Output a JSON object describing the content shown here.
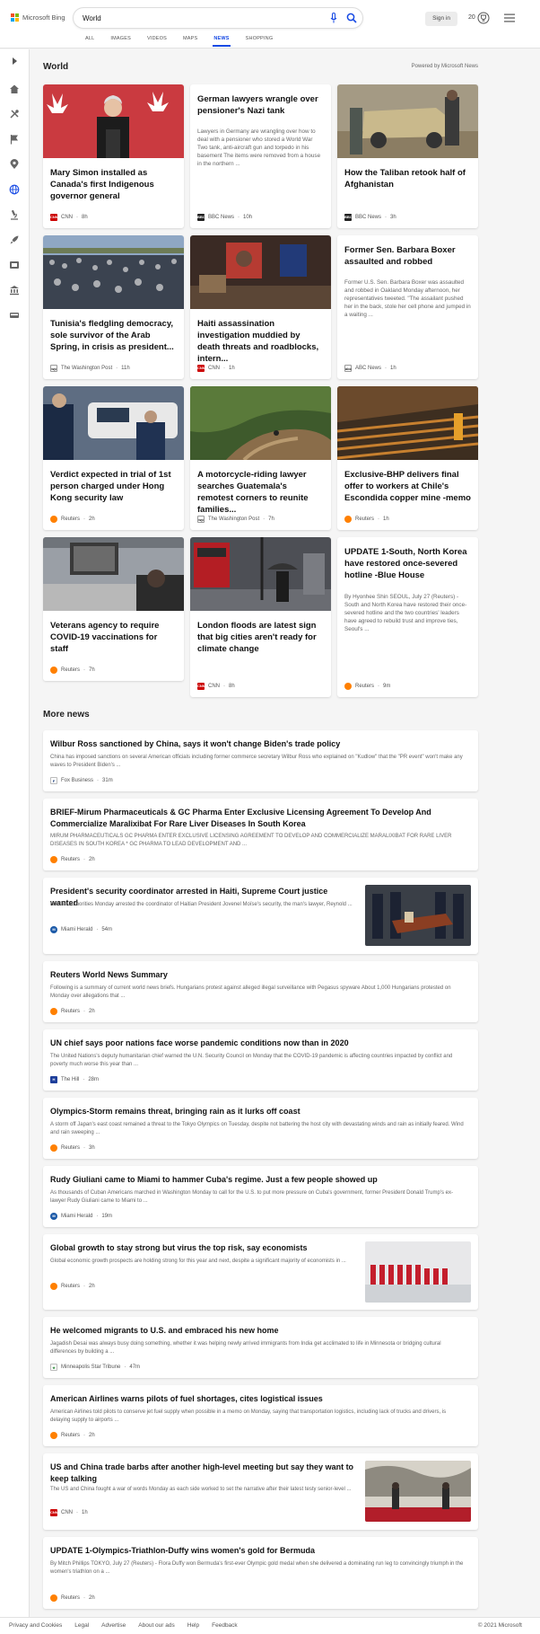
{
  "brand": {
    "name": "Microsoft Bing",
    "colors": [
      "#f25022",
      "#7fba00",
      "#00a4ef",
      "#ffb900"
    ]
  },
  "search": {
    "query": "World",
    "placeholder": ""
  },
  "header": {
    "signin_label": "Sign in",
    "rewards_count": "20"
  },
  "tabs": [
    "ALL",
    "IMAGES",
    "VIDEOS",
    "MAPS",
    "NEWS",
    "SHOPPING"
  ],
  "active_tab": "NEWS",
  "accent_color": "#174ae4",
  "rail_icons": [
    "expand-icon",
    "home-icon",
    "tools-icon",
    "flag-icon",
    "map-pin-icon",
    "globe-icon",
    "microscope-icon",
    "rocket-icon",
    "film-icon",
    "bank-icon",
    "car-icon"
  ],
  "section": {
    "title": "World",
    "powered_by": "Powered by Microsoft News"
  },
  "cards": [
    {
      "title": "Mary Simon installed as Canada's first Indigenous governor general",
      "desc": "",
      "source": "CNN",
      "time": "8h"
    },
    {
      "title": "German lawyers wrangle over pensioner's Nazi tank",
      "desc": "Lawyers in Germany are wrangling over how to deal with a pensioner who stored a World War Two tank, anti-aircraft gun and torpedo in his basement The items were removed from a house in the northern ...",
      "source": "BBC News",
      "time": "10h"
    },
    {
      "title": "How the Taliban retook half of Afghanistan",
      "desc": "",
      "source": "BBC News",
      "time": "3h"
    },
    {
      "title": "Tunisia's fledgling democracy, sole survivor of the Arab Spring, in crisis as president...",
      "desc": "",
      "source": "The Washington Post",
      "time": "11h"
    },
    {
      "title": "Haiti assassination investigation muddied by death threats and roadblocks, intern...",
      "desc": "",
      "source": "CNN",
      "time": "1h"
    },
    {
      "title": "Former Sen. Barbara Boxer assaulted and robbed",
      "desc": "Former U.S. Sen. Barbara Boxer was assaulted and robbed in Oakland Monday afternoon, her representatives tweeted. \"The assailant pushed her in the back, stole her cell phone and jumped in a waiting ...",
      "source": "ABC News",
      "time": "1h"
    },
    {
      "title": "Verdict expected in trial of 1st person charged under Hong Kong security law",
      "desc": "",
      "source": "Reuters",
      "time": "2h"
    },
    {
      "title": "A motorcycle-riding lawyer searches Guatemala's remotest corners to reunite families...",
      "desc": "",
      "source": "The Washington Post",
      "time": "7h"
    },
    {
      "title": "Exclusive-BHP delivers final offer to workers at Chile's Escondida copper mine -memo",
      "desc": "",
      "source": "Reuters",
      "time": "1h"
    },
    {
      "title": "Veterans agency to require COVID-19 vaccinations for staff",
      "desc": "",
      "source": "Reuters",
      "time": "7h"
    },
    {
      "title": "London floods are latest sign that big cities aren't ready for climate change",
      "desc": "",
      "source": "CNN",
      "time": "8h"
    },
    {
      "title": "UPDATE 1-South, North Korea have restored once-severed hotline -Blue House",
      "desc": "By Hyonhee Shin SEOUL, July 27 (Reuters) - South and North Korea have restored their once-severed hotline and the two countries' leaders have agreed to rebuild trust and improve ties, Seoul's ...",
      "source": "Reuters",
      "time": "9m"
    }
  ],
  "more_news": {
    "title": "More news",
    "items": [
      {
        "title": "Wilbur Ross sanctioned by China, says it won't change Biden's trade policy",
        "desc": "China has imposed sanctions on several American officials including former commerce secretary Wilbur Ross who explained on \"Kudlow\" that the \"PR event\" won't make any waves to President Biden's ...",
        "source": "Fox Business",
        "time": "31m"
      },
      {
        "title": "BRIEF-Mirum Pharmaceuticals & GC Pharma Enter Exclusive Licensing Agreement To Develop And Commercialize Maralixibat For Rare Liver Diseases In South Korea",
        "desc": "MIRUM PHARMACEUTICALS GC PHARMA ENTER EXCLUSIVE LICENSING AGREEMENT TO DEVELOP AND COMMERCIALIZE MARALIXIBAT FOR RARE LIVER DISEASES IN SOUTH KOREA * GC PHARMA TO LEAD DEVELOPMENT AND ...",
        "source": "Reuters",
        "time": "2h"
      },
      {
        "title": "President's security coordinator arrested in Haiti, Supreme Court justice wanted",
        "desc": "Haitian authorities Monday arrested the coordinator of Haitian President Jovenel Moïse's security, the man's lawyer, Reynold ...",
        "source": "Miami Herald",
        "time": "54m"
      },
      {
        "title": "Reuters World News Summary",
        "desc": "Following is a summary of current world news briefs. Hungarians protest against alleged illegal surveillance with Pegasus spyware About 1,000 Hungarians protested on Monday over allegations that ...",
        "source": "Reuters",
        "time": "2h"
      },
      {
        "title": "UN chief says poor nations face worse pandemic conditions now than in 2020",
        "desc": "The United Nations's deputy humanitarian chief warned the U.N. Security Council on Monday that the COVID-19 pandemic is affecting countries impacted by conflict and poverty much worse this year than ...",
        "source": "The Hill",
        "time": "28m"
      },
      {
        "title": "Olympics-Storm remains threat, bringing rain as it lurks off coast",
        "desc": "A storm off Japan's east coast remained a threat to the Tokyo Olympics on Tuesday, despite not battering the host city with devastating winds and rain as initially feared. Wind and rain sweeping ...",
        "source": "Reuters",
        "time": "3h"
      },
      {
        "title": "Rudy Giuliani came to Miami to hammer Cuba's regime. Just a few people showed up",
        "desc": "As thousands of Cuban Americans marched in Washington Monday to call for the U.S. to put more pressure on Cuba's government, former President Donald Trump's ex-lawyer Rudy Giuliani came to Miami to ...",
        "source": "Miami Herald",
        "time": "19m"
      },
      {
        "title": "Global growth to stay strong but virus the top risk, say economists",
        "desc": "Global economic growth prospects are holding strong for this year and next, despite a significant majority of economists in ...",
        "source": "Reuters",
        "time": "2h"
      },
      {
        "title": "He welcomed migrants to U.S. and embraced his new home",
        "desc": "Jagadish Desai was always busy doing something, whether it was helping newly arrived immigrants from India get acclimated to life in Minnesota or bridging cultural differences by building a ...",
        "source": "Minneapolis Star Tribune",
        "time": "47m"
      },
      {
        "title": "American Airlines warns pilots of fuel shortages, cites logistical issues",
        "desc": "American Airlines told pilots to conserve jet fuel supply when possible in a memo on Monday, saying that transportation logistics, including lack of trucks and drivers, is delaying supply to airports ...",
        "source": "Reuters",
        "time": "2h"
      },
      {
        "title": "US and China trade barbs after another high-level meeting but say they want to keep talking",
        "desc": "The US and China fought a war of words Monday as each side worked to set the narrative after their latest testy senior-level ...",
        "source": "CNN",
        "time": "1h"
      },
      {
        "title": "UPDATE 1-Olympics-Triathlon-Duffy wins women's gold for Bermuda",
        "desc": "By Mitch Phillips TOKYO, July 27 (Reuters) - Flora Duffy won Bermuda's first-ever Olympic gold medal when she delivered a dominating run leg to convincingly triumph in the women's triathlon on a ...",
        "source": "Reuters",
        "time": "2h"
      }
    ]
  },
  "footer": {
    "links": [
      "Privacy and Cookies",
      "Legal",
      "Advertise",
      "About our ads",
      "Help",
      "Feedback"
    ],
    "copyright": "© 2021 Microsoft"
  }
}
